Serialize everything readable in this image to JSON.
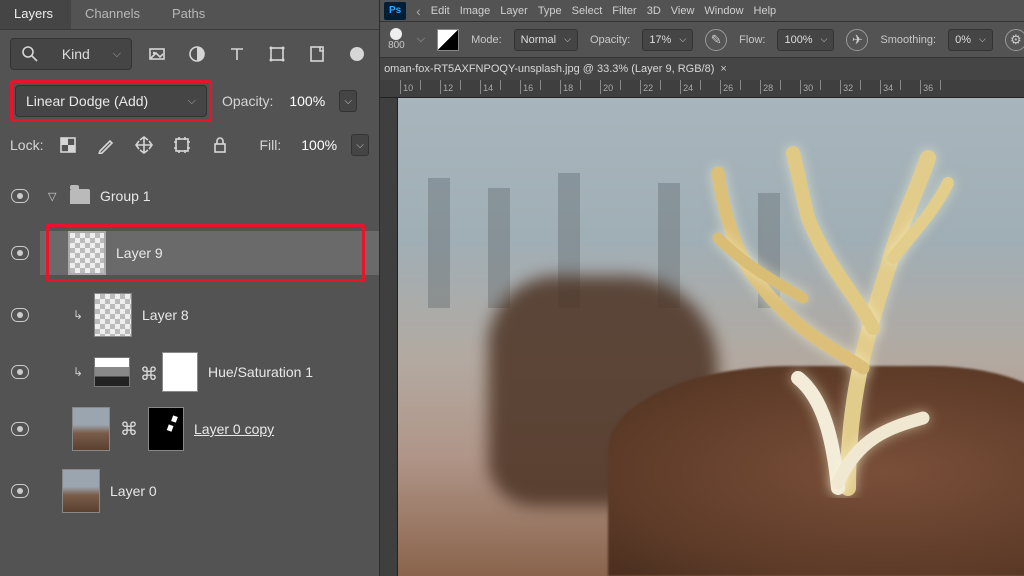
{
  "panel": {
    "tabs": [
      "Layers",
      "Channels",
      "Paths"
    ],
    "active_tab": 0,
    "filter_label": "Kind",
    "blend_mode": "Linear Dodge (Add)",
    "opacity_label": "Opacity:",
    "opacity_value": "100%",
    "lock_label": "Lock:",
    "fill_label": "Fill:",
    "fill_value": "100%"
  },
  "layers": [
    {
      "name": "Group 1",
      "kind": "group",
      "indent": 1
    },
    {
      "name": "Layer 9",
      "kind": "layer",
      "indent": 2,
      "selected": true,
      "highlight": true
    },
    {
      "name": "Layer 8",
      "kind": "layer",
      "indent": 3,
      "clipped": true
    },
    {
      "name": "Hue/Saturation 1",
      "kind": "adjustment",
      "indent": 3,
      "clipped": true
    },
    {
      "name": "Layer 0 copy ",
      "kind": "layer",
      "indent": 3,
      "underline": true
    },
    {
      "name": "Layer 0",
      "kind": "layer",
      "indent": 2
    }
  ],
  "menu": [
    "Edit",
    "Image",
    "Layer",
    "Type",
    "Select",
    "Filter",
    "3D",
    "View",
    "Window",
    "Help"
  ],
  "options": {
    "brush_size": "800",
    "mode_label": "Mode:",
    "mode_value": "Normal",
    "opacity_label": "Opacity:",
    "opacity_value": "17%",
    "flow_label": "Flow:",
    "flow_value": "100%",
    "smoothing_label": "Smoothing:",
    "smoothing_value": "0%"
  },
  "document_tab": "oman-fox-RT5AXFNPOQY-unsplash.jpg @ 33.3% (Layer 9, RGB/8)",
  "ruler_ticks": [
    10,
    12,
    14,
    16,
    18,
    20,
    22,
    24,
    26,
    28,
    30,
    32,
    34,
    36
  ]
}
